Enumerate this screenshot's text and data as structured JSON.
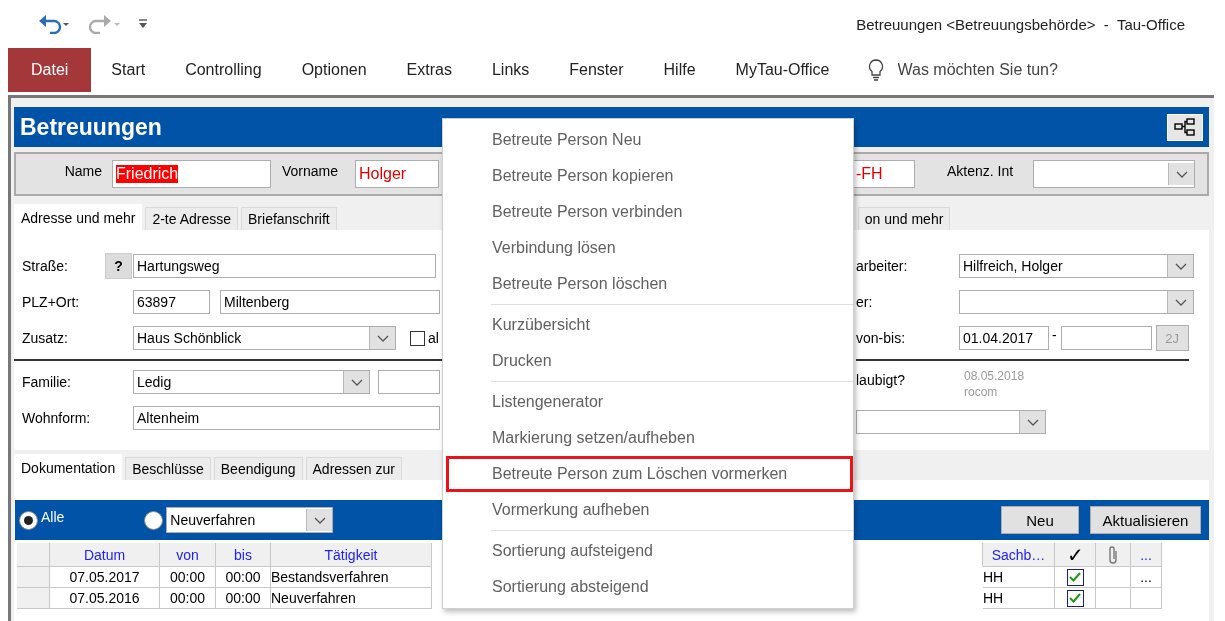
{
  "window": {
    "title": "Betreuungen <Betreuungsbehörde>  -  Tau-Office"
  },
  "ribbon": {
    "tabs": [
      {
        "label": "Datei",
        "kind": "file"
      },
      {
        "label": "Start",
        "kind": "tab"
      },
      {
        "label": "Controlling",
        "kind": "tab"
      },
      {
        "label": "Optionen",
        "kind": "tab"
      },
      {
        "label": "Extras",
        "kind": "tab"
      },
      {
        "label": "Links",
        "kind": "tab"
      },
      {
        "label": "Fenster",
        "kind": "tab"
      },
      {
        "label": "Hilfe",
        "kind": "tab"
      },
      {
        "label": "MyTau-Office",
        "kind": "tab"
      }
    ],
    "search": {
      "placeholder": "Was möchten Sie tun?"
    }
  },
  "form": {
    "title": "Betreuungen",
    "name_row": [
      {
        "kind": "text",
        "label": "Name",
        "value": "Friedrich",
        "text_selected": true
      },
      {
        "kind": "text",
        "label": "Vorname",
        "value": "Holger",
        "text_selected": false
      },
      {
        "kind": "text",
        "value": "-FH",
        "text_selected": false
      },
      {
        "kind": "combo",
        "label": "Aktenz. Int"
      }
    ],
    "tabs": [
      {
        "label": "Adresse und mehr",
        "selected": true
      },
      {
        "label": "2-te Adresse",
        "selected": false
      },
      {
        "label": "Briefanschrift",
        "selected": false
      },
      {
        "label": "on und mehr",
        "selected": false
      }
    ],
    "left_rows": [
      {
        "kind": "help_text",
        "label": "Straße:",
        "help": "?",
        "value": "Hartungsweg"
      },
      {
        "kind": "zip_city",
        "label": "PLZ+Ort:",
        "zip": "63897",
        "value": "Miltenberg"
      },
      {
        "kind": "combo_check",
        "label": "Zusatz:",
        "value": "Haus Schönblick",
        "checked": false,
        "check_label": "al"
      },
      {
        "kind": "combo_field",
        "label": "Familie:",
        "value": "Ledig"
      },
      {
        "kind": "text",
        "label": "Wohnform:",
        "value": "Altenheim"
      }
    ],
    "right_rows": [
      {
        "kind": "combo",
        "label": "arbeiter:",
        "value": "Hilfreich, Holger"
      },
      {
        "kind": "combo",
        "label": "er:"
      },
      {
        "kind": "range",
        "label": "von-bis:",
        "from": "01.04.2017",
        "separator": "-",
        "button": "2J"
      },
      {
        "kind": "stamp",
        "label": "laubigt?",
        "date": "08.05.2018",
        "user": "rocom"
      },
      {
        "kind": "combo_wide"
      }
    ],
    "bottom_tabs": [
      {
        "label": "Dokumentation",
        "selected": true
      },
      {
        "label": "Beschlüsse",
        "selected": false
      },
      {
        "label": "Beendigung",
        "selected": false
      },
      {
        "label": "Adressen zur",
        "selected": false
      }
    ],
    "filter": {
      "options": [
        {
          "label": "Alle",
          "selected": true
        },
        {
          "combo": "Neuverfahren",
          "selected": false
        }
      ],
      "buttons": [
        "Neu",
        "Aktualisieren"
      ]
    },
    "table": {
      "columns": [
        "Datum",
        "von",
        "bis",
        "Tätigkeit"
      ],
      "right_columns": [
        {
          "kind": "text",
          "label": "Sachb…"
        },
        {
          "kind": "check",
          "label": "✓"
        },
        {
          "kind": "attachment"
        },
        {
          "kind": "text",
          "label": "..."
        }
      ],
      "rows": [
        {
          "cells": [
            "07.05.2017",
            "00:00",
            "00:00",
            "Bestandsverfahren"
          ],
          "clerk": "HH",
          "done": true,
          "more": "..."
        },
        {
          "cells": [
            "07.05.2016",
            "00:00",
            "00:00",
            "Neuverfahren"
          ],
          "clerk": "HH",
          "done": true
        }
      ]
    }
  },
  "context_menu": {
    "groups": [
      [
        {
          "label": "Betreute Person Neu",
          "highlighted": false
        },
        {
          "label": "Betreute Person kopieren",
          "highlighted": false
        },
        {
          "label": "Betreute Person verbinden",
          "highlighted": false
        },
        {
          "label": "Verbindung lösen",
          "highlighted": false
        },
        {
          "label": "Betreute Person löschen",
          "highlighted": false
        }
      ],
      [
        {
          "label": "Kurzübersicht",
          "highlighted": false
        },
        {
          "label": "Drucken",
          "highlighted": false
        }
      ],
      [
        {
          "label": "Listengenerator",
          "highlighted": false
        },
        {
          "label": "Markierung setzen/aufheben",
          "highlighted": false
        },
        {
          "label": "Betreute Person zum Löschen vormerken",
          "highlighted": true
        },
        {
          "label": "Vormerkung aufheben",
          "highlighted": false
        }
      ],
      [
        {
          "label": "Sortierung aufsteigend",
          "highlighted": false
        },
        {
          "label": "Sortierung absteigend",
          "highlighted": false
        }
      ]
    ]
  }
}
